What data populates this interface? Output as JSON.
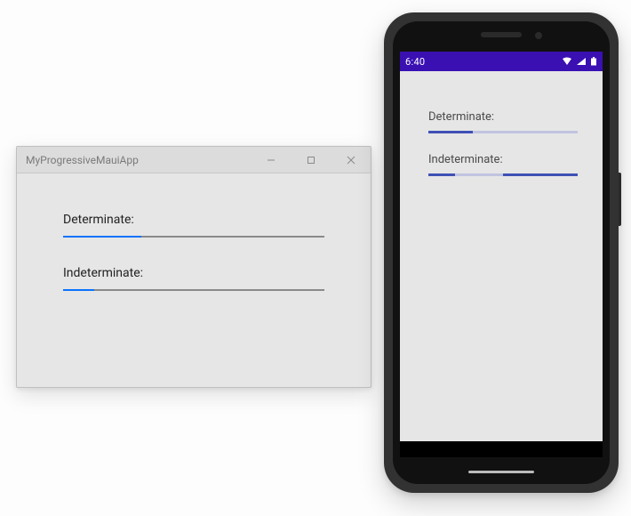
{
  "desktop": {
    "window_title": "MyProgressiveMauiApp",
    "labels": {
      "determinate": "Determinate:",
      "indeterminate": "Indeterminate:"
    },
    "determinate_progress_percent": 30
  },
  "phone": {
    "statusbar": {
      "time": "6:40"
    },
    "labels": {
      "determinate": "Determinate:",
      "indeterminate": "Indeterminate:"
    },
    "determinate_progress_percent": 30
  },
  "colors": {
    "desktop_accent": "#0a73ff",
    "android_statusbar": "#3a10b3",
    "android_accent": "#3f51b5"
  }
}
